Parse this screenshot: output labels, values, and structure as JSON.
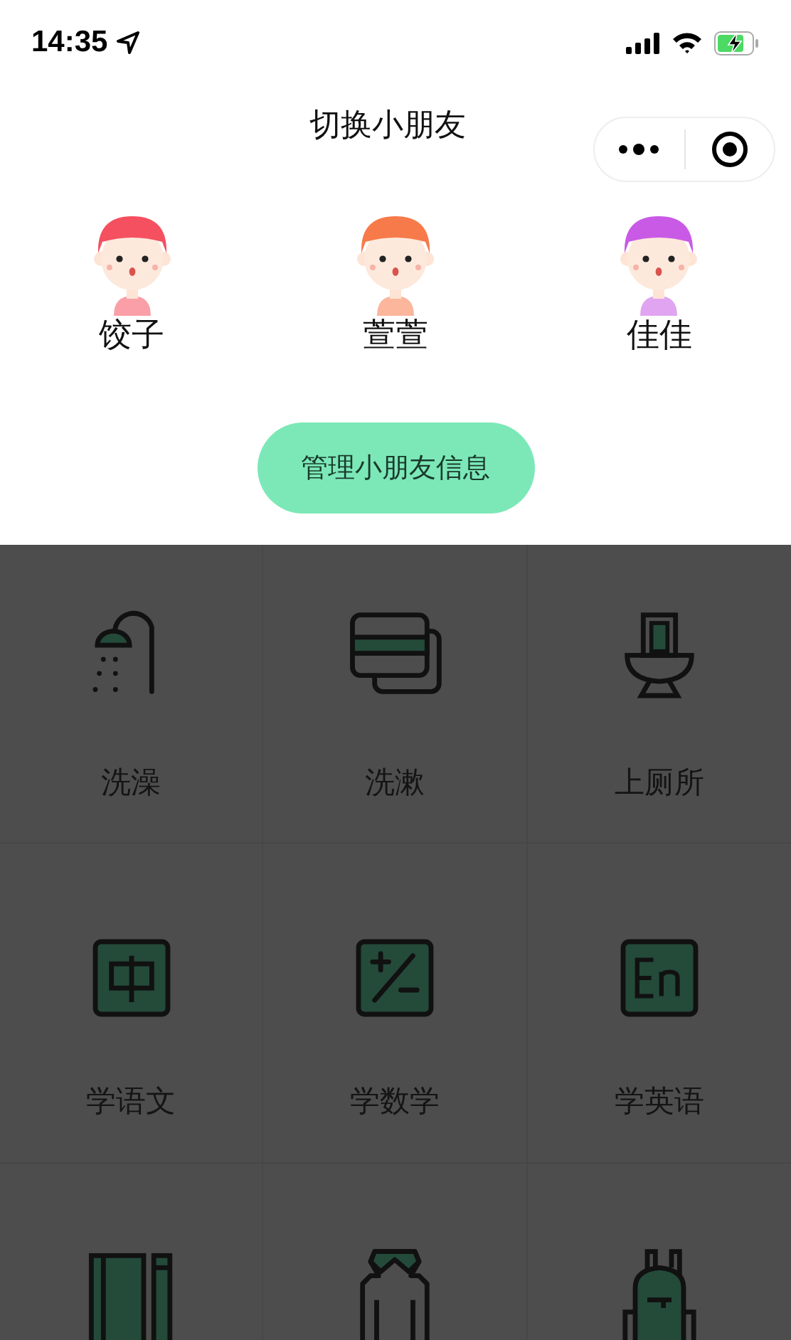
{
  "status_bar": {
    "time": "14:35"
  },
  "nav": {
    "title": "切换小朋友"
  },
  "children": [
    {
      "name": "饺子",
      "color": "#f5505f"
    },
    {
      "name": "萱萱",
      "color": "#f77a4a"
    },
    {
      "name": "佳佳",
      "color": "#c95ae6"
    }
  ],
  "manage_button": {
    "label": "管理小朋友信息"
  },
  "tasks": [
    {
      "kind": "shower",
      "label": "洗澡"
    },
    {
      "kind": "towel",
      "label": "洗漱"
    },
    {
      "kind": "toilet",
      "label": "上厕所"
    },
    {
      "kind": "chinese",
      "label": "学语文"
    },
    {
      "kind": "math",
      "label": "学数学"
    },
    {
      "kind": "english",
      "label": "学英语"
    },
    {
      "kind": "notebook"
    },
    {
      "kind": "clothes"
    },
    {
      "kind": "backpack"
    }
  ]
}
